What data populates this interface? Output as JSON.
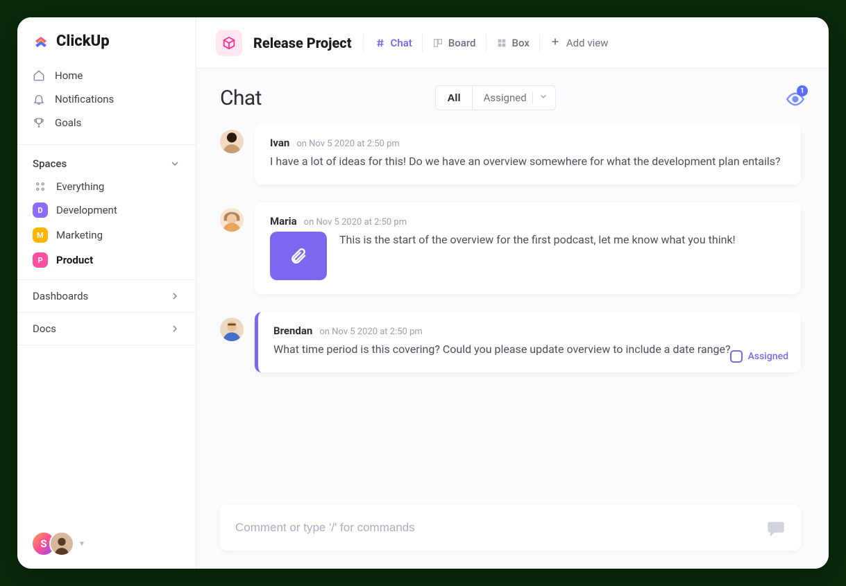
{
  "brand": {
    "name": "ClickUp"
  },
  "sidebar": {
    "primary": [
      {
        "label": "Home"
      },
      {
        "label": "Notifications"
      },
      {
        "label": "Goals"
      }
    ],
    "spaces_header": "Spaces",
    "everything": "Everything",
    "spaces": [
      {
        "letter": "D",
        "label": "Development",
        "color": "#8c6bff"
      },
      {
        "letter": "M",
        "label": "Marketing",
        "color": "#ffb400"
      },
      {
        "letter": "P",
        "label": "Product",
        "color": "#ff4fa3"
      }
    ],
    "bottom": [
      {
        "label": "Dashboards"
      },
      {
        "label": "Docs"
      }
    ],
    "user_initial": "S"
  },
  "header": {
    "project": "Release Project",
    "views": [
      {
        "label": "Chat"
      },
      {
        "label": "Board"
      },
      {
        "label": "Box"
      }
    ],
    "add_view": "Add view"
  },
  "chat": {
    "title": "Chat",
    "filters": {
      "all": "All",
      "assigned": "Assigned"
    },
    "watchers_count": "1",
    "messages": [
      {
        "author": "Ivan",
        "time": "on Nov 5 2020 at 2:50 pm",
        "body": "I have a lot of ideas for this! Do we have an overview somewhere for what the development plan entails?"
      },
      {
        "author": "Maria",
        "time": "on Nov 5 2020 at 2:50 pm",
        "body": "This is the start of the overview for the first podcast, let me know what you think!",
        "has_attachment": true
      },
      {
        "author": "Brendan",
        "time": "on Nov 5 2020 at 2:50 pm",
        "body": "What time period is this covering? Could you please update overview to include a date range?",
        "assigned_tag": "Assigned"
      }
    ],
    "composer_placeholder": "Comment or type '/' for commands"
  }
}
